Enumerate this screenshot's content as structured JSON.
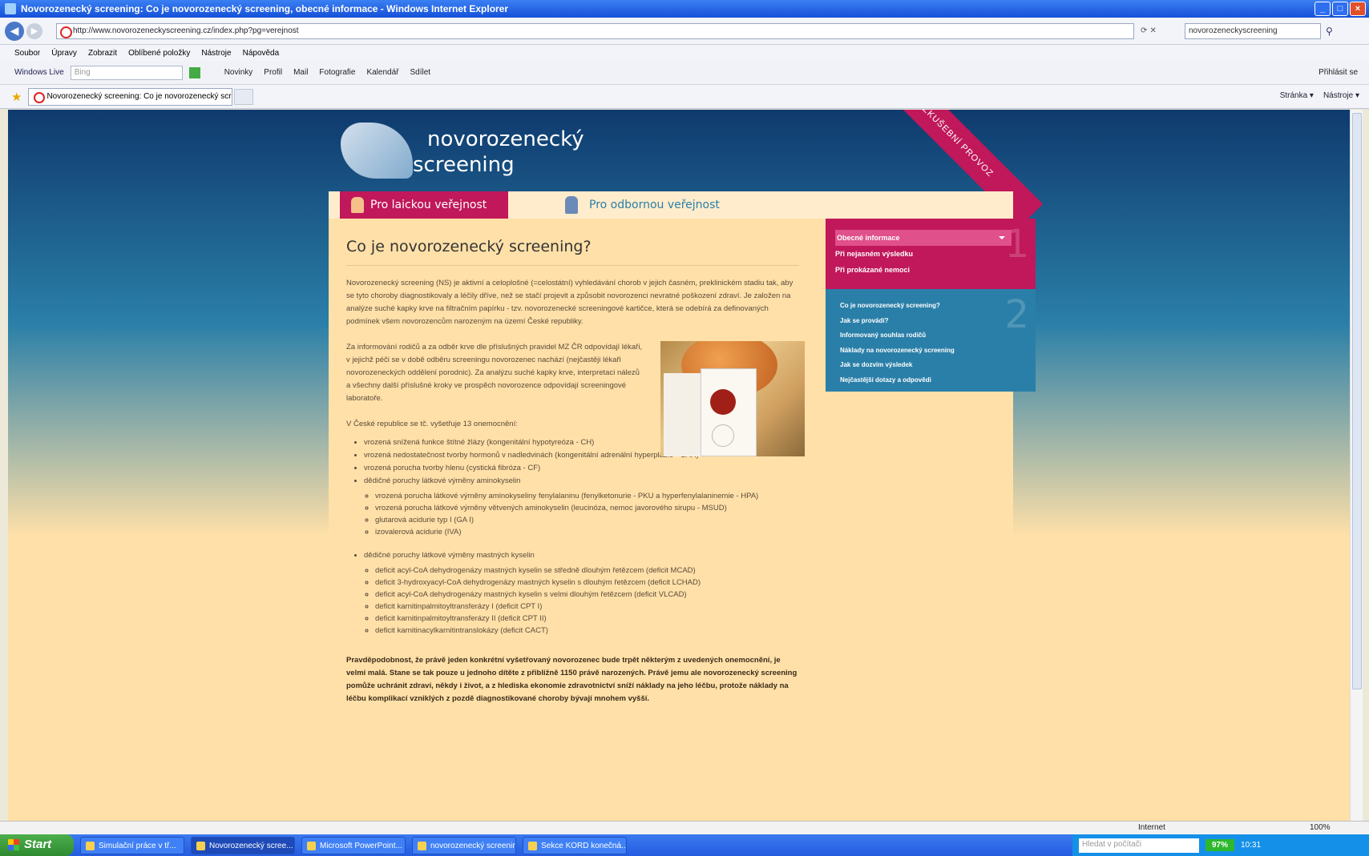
{
  "window": {
    "title": "Novorozenecký screening: Co je novorozenecký screening, obecné informace - Windows Internet Explorer"
  },
  "address": {
    "url": "http://www.novorozeneckyscreening.cz/index.php?pg=verejnost",
    "search": "novorozeneckyscreening"
  },
  "menu": [
    "Soubor",
    "Úpravy",
    "Zobrazit",
    "Oblíbené položky",
    "Nástroje",
    "Nápověda"
  ],
  "links": {
    "windows_live": "Windows Live",
    "search_placeholder": "Bing",
    "items": [
      "Novinky",
      "Profil",
      "Mail",
      "Fotografie",
      "Kalendář",
      "Sdílet"
    ],
    "signin": "Přihlásit se"
  },
  "tab": {
    "label": "Novorozenecký screening: Co je novorozenecký scre...",
    "tools": [
      "Stránka ▾",
      "Nástroje ▾"
    ]
  },
  "site": {
    "logo": [
      "novorozenecký",
      "screening"
    ],
    "ribbon": "ZKUŠEBNÍ PROVOZ",
    "tabs": [
      "Pro laickou veřejnost",
      "Pro odbornou veřejnost"
    ],
    "title": "Co je novorozenecký screening?",
    "para1": "Novorozenecký screening (NS) je aktivní a celoplošné (=celostátní) vyhledávání chorob v jejich časném, preklinickém stadiu tak, aby se tyto choroby diagnostikovaly a léčily dříve, než se stačí projevit a způsobit novorozenci nevratné poškození zdraví. Je založen na analýze suché kapky krve na filtračním papírku - tzv. novorozenecké screeningové kartičce, která se odebírá za definovaných podmínek všem novorozencům narozeným na území České republiky.",
    "para2": "Za informování rodičů a za odběr krve dle příslušných pravidel MZ ČR odpovídají lékaři, v jejichž péči se v době odběru screeningu novorozenec nachází (nejčastěji lékaři novorozeneckých oddělení porodnic). Za analýzu suché kapky krve, interpretaci nálezů a všechny další příslušné kroky ve prospěch novorozence odpovídají screeningové laboratoře.",
    "intro": "V České republice se tč. vyšetřuje 13 onemocnění:",
    "list": [
      "vrozená snížená funkce štítné žlázy (kongenitální hypotyreóza - CH)",
      "vrozená nedostatečnost tvorby hormonů v nadledvinách (kongenitální adrenální hyperplazie - CAH)",
      "vrozená porucha tvorby hlenu (cystická fibróza - CF)",
      "dědičné poruchy látkové výměny aminokyselin"
    ],
    "sub1": [
      "vrozená porucha látkové výměny aminokyseliny fenylalaninu (fenylketonurie - PKU a hyperfenylalaninemie - HPA)",
      "vrozená porucha látkové výměny větvených aminokyselin (leucinóza, nemoc javorového sirupu - MSUD)",
      "glutarová acidurie typ I (GA I)",
      "izovalerová acidurie (IVA)"
    ],
    "list2": "dědičné poruchy látkové výměny mastných kyselin",
    "sub2": [
      "deficit acyl-CoA dehydrogenázy mastných kyselin se středně dlouhým řetězcem (deficit MCAD)",
      "deficit 3-hydroxyacyl-CoA dehydrogenázy mastných kyselin s dlouhým řetězcem (deficit LCHAD)",
      "deficit acyl-CoA dehydrogenázy mastných kyselin s velmi dlouhým řetězcem (deficit VLCAD)",
      "deficit karnitinpalmitoyltransferázy I (deficit CPT I)",
      "deficit karnitinpalmitoyltransferázy II (deficit CPT II)",
      "deficit karnitinacylkarnitintranslokázy (deficit CACT)"
    ],
    "last": "Pravděpodobnost, že právě jeden konkrétní vyšetřovaný novorozenec bude trpět některým z uvedených onemocnění, je velmi malá. Stane se tak pouze u jednoho dítěte z přibližně 1150 právě narozených. Právě jemu ale novorozenecký screening pomůže uchránit zdraví, někdy i život, a z hlediska ekonomie zdravotnictví sníží náklady na jeho léčbu, protože náklady na léčbu komplikací vzniklých z pozdě diagnostikované choroby bývají mnohem vyšší.",
    "side1": {
      "num": "1",
      "items": [
        "Obecné informace",
        "Při nejasném výsledku",
        "Při prokázané nemoci"
      ]
    },
    "side2": {
      "num": "2",
      "items": [
        "Co je novorozenecký screening?",
        "Jak se provádí?",
        "Informovaný souhlas rodičů",
        "Náklady na novorozenecký screening",
        "Jak se dozvím výsledek",
        "Nejčastější dotazy a odpovědi"
      ]
    }
  },
  "status": {
    "zone": "Internet",
    "zoom": "100%"
  },
  "taskbar": {
    "start": "Start",
    "items": [
      "Simulační práce v tř...",
      "Novorozenecký scree...",
      "Microsoft PowerPoint...",
      "novorozenecký screening",
      "Sekce KORD konečná..."
    ],
    "search": "Hledat v počítači",
    "battery": "97%",
    "time": "10:31"
  },
  "colors": {
    "accent": "#c0185a",
    "blue": "#2a7fa8",
    "page": "#ffe0a8"
  }
}
